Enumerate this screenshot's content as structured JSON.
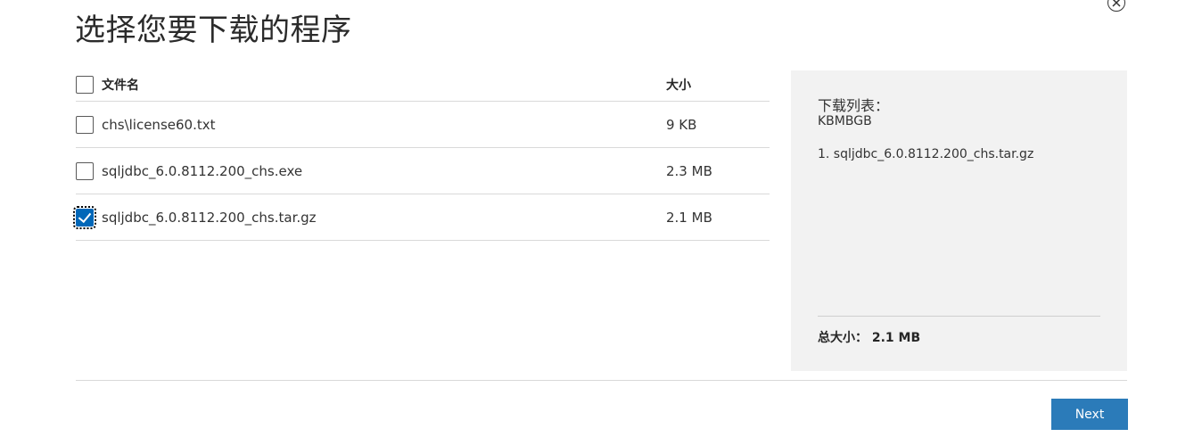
{
  "dialog": {
    "title": "选择您要下载的程序",
    "close_icon": "close-circle-icon"
  },
  "table": {
    "header": {
      "name": "文件名",
      "size": "大小"
    },
    "rows": [
      {
        "name": "chs\\license60.txt",
        "size": "9 KB",
        "checked": false
      },
      {
        "name": "sqljdbc_6.0.8112.200_chs.exe",
        "size": "2.3 MB",
        "checked": false
      },
      {
        "name": "sqljdbc_6.0.8112.200_chs.tar.gz",
        "size": "2.1 MB",
        "checked": true
      }
    ]
  },
  "download_list": {
    "title": "下载列表：",
    "subtitle": "KBMBGB",
    "items": [
      "1. sqljdbc_6.0.8112.200_chs.tar.gz"
    ],
    "total": "总大小： 2.1 MB"
  },
  "footer": {
    "next_label": "Next"
  },
  "colors": {
    "accent": "#2b7bb9",
    "panel_bg": "#f2f2f2"
  }
}
